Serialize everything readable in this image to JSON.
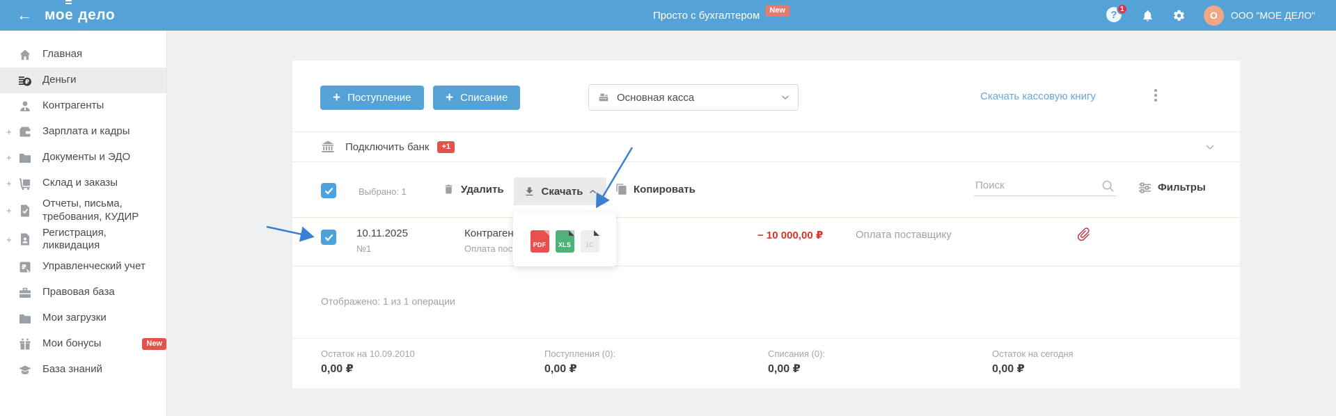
{
  "brand": {
    "prefix": "мо",
    "accent": "е",
    "suffix": "дело"
  },
  "header": {
    "promo": "Просто с бухгалтером",
    "promo_badge": "New",
    "help_badge": "1",
    "account_initial": "О",
    "account_name": "ООО \"МОЕ ДЕЛО\""
  },
  "sidebar": {
    "items": [
      {
        "label": "Главная"
      },
      {
        "label": "Деньги",
        "active": true
      },
      {
        "label": "Контрагенты"
      },
      {
        "label": "Зарплата и кадры",
        "expandable": true
      },
      {
        "label": "Документы и ЭДО",
        "expandable": true
      },
      {
        "label": "Склад и заказы",
        "expandable": true
      },
      {
        "label": "Отчеты, письма, требования, КУДИР",
        "expandable": true
      },
      {
        "label": "Регистрация, ликвидация",
        "expandable": true
      },
      {
        "label": "Управленческий учет"
      },
      {
        "label": "Правовая база"
      },
      {
        "label": "Мои загрузки"
      },
      {
        "label": "Мои бонусы",
        "badge": "New"
      },
      {
        "label": "База знаний"
      }
    ]
  },
  "toolbar": {
    "income_button": "Поступление",
    "expense_button": "Списание",
    "cashbox_selected": "Основная касса",
    "download_book_link": "Скачать кассовую книгу"
  },
  "bank": {
    "label": "Подключить банк",
    "badge": "+1"
  },
  "selection": {
    "selected_text": "Выбрано: 1",
    "delete_label": "Удалить",
    "download_label": "Скачать",
    "copy_label": "Копировать",
    "search_placeholder": "Поиск",
    "filters_label": "Фильтры"
  },
  "download_menu": {
    "pdf": "PDF",
    "xls": "XLS",
    "onec": "1С"
  },
  "operation": {
    "date": "10.11.2025",
    "number": "№1",
    "contractor": "Контраген",
    "contractor_note": "Оплата пос",
    "amount": "− 10 000,00 ₽",
    "purpose": "Оплата поставщику"
  },
  "footer": {
    "shown_text": "Отображено: 1 из 1 операции",
    "summary": [
      {
        "label": "Остаток на 10.09.2010",
        "value": "0,00 ₽"
      },
      {
        "label": "Поступления (0):",
        "value": "0,00 ₽"
      },
      {
        "label": "Списания (0):",
        "value": "0,00 ₽"
      },
      {
        "label": "Остаток на сегодня",
        "value": "0,00 ₽"
      }
    ]
  },
  "colors": {
    "accent_blue": "#55a2d7",
    "link_blue": "#65a8dd",
    "badge_red": "#e25349",
    "amount_red": "#d7342a",
    "selected_row_border": "#e9ecce"
  }
}
